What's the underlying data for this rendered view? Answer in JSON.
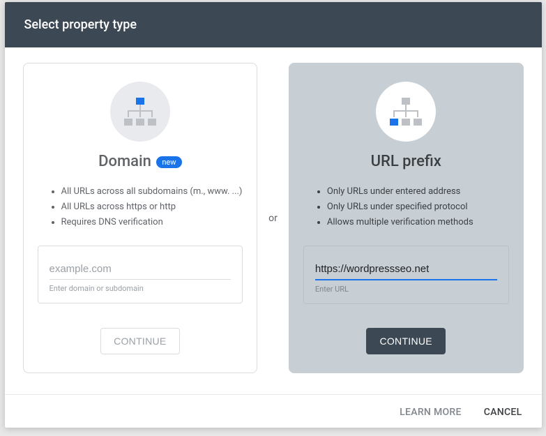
{
  "header": {
    "title": "Select property type"
  },
  "separator": "or",
  "domain_card": {
    "title": "Domain",
    "badge": "new",
    "features": [
      "All URLs across all subdomains (m., www. ...)",
      "All URLs across https or http",
      "Requires DNS verification"
    ],
    "input_placeholder": "example.com",
    "input_helper": "Enter domain or subdomain",
    "button": "CONTINUE"
  },
  "url_card": {
    "title": "URL prefix",
    "features": [
      "Only URLs under entered address",
      "Only URLs under specified protocol",
      "Allows multiple verification methods"
    ],
    "input_value": "https://wordpressseo.net",
    "input_helper": "Enter URL",
    "button": "CONTINUE"
  },
  "footer": {
    "learn_more": "LEARN MORE",
    "cancel": "CANCEL"
  }
}
